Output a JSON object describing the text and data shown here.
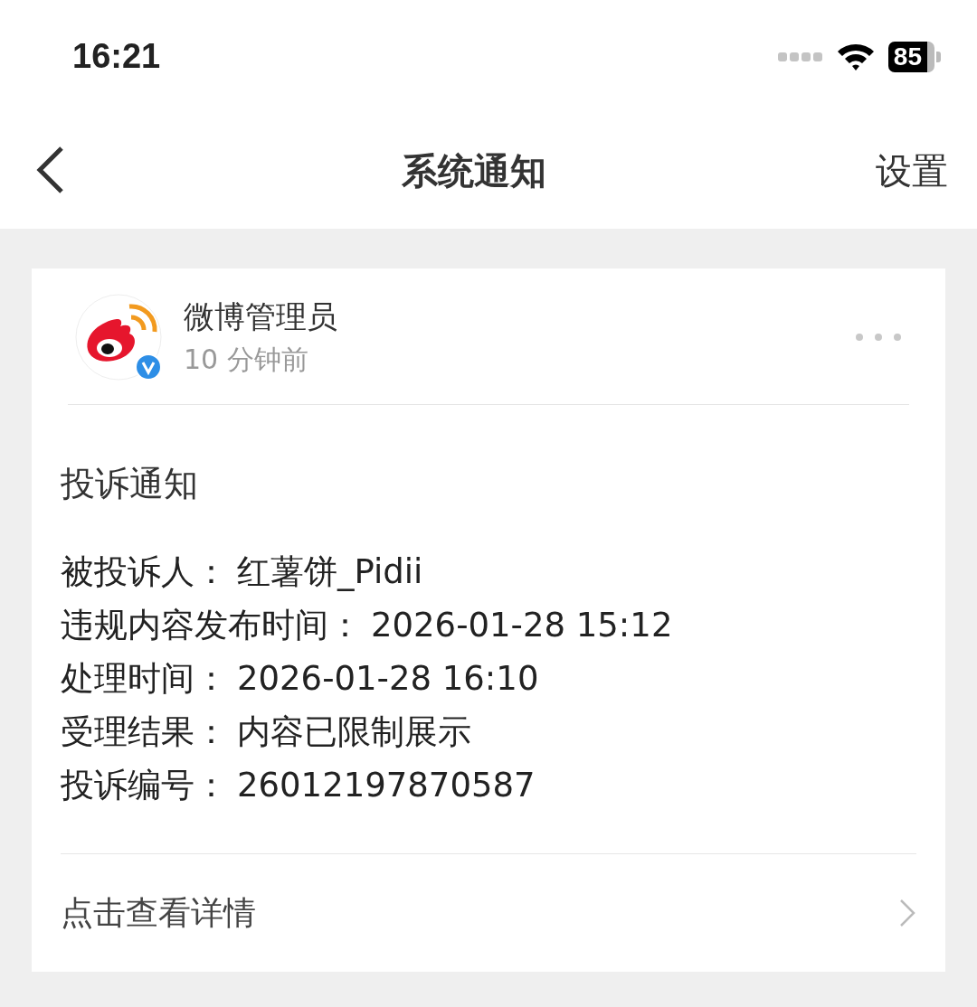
{
  "status_bar": {
    "time": "16:21",
    "battery": "85"
  },
  "nav_bar": {
    "title": "系统通知",
    "action": "设置"
  },
  "notification": {
    "sender": "微博管理员",
    "verified": true,
    "time": "10 分钟前",
    "heading": "投诉通知",
    "details": [
      {
        "label": "被投诉人：",
        "value": "红薯饼_Pidii"
      },
      {
        "label": "违规内容发布时间：",
        "value": "2026-01-28 15:12"
      },
      {
        "label": "处理时间：",
        "value": "2026-01-28 16:10"
      },
      {
        "label": "受理结果：",
        "value": "内容已限制展示"
      },
      {
        "label": "投诉编号：",
        "value": "26012197870587"
      }
    ],
    "link": "点击查看详情"
  }
}
